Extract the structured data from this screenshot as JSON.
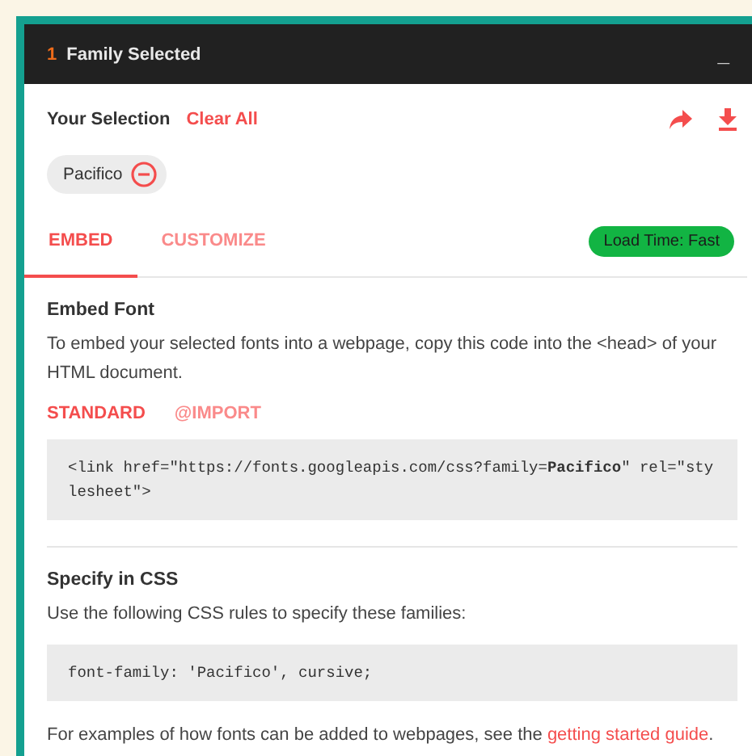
{
  "header": {
    "count": "1",
    "title": "Family Selected",
    "minimize": "_"
  },
  "selection": {
    "label": "Your Selection",
    "clear": "Clear All",
    "families": [
      {
        "name": "Pacifico"
      }
    ]
  },
  "tabs": [
    {
      "label": "EMBED",
      "selected": true
    },
    {
      "label": "CUSTOMIZE",
      "selected": false
    }
  ],
  "load_time": "Load Time: Fast",
  "embed": {
    "title": "Embed Font",
    "description": "To embed your selected fonts into a webpage, copy this code into the <head> of your HTML document.",
    "subtabs": [
      {
        "label": "STANDARD",
        "selected": true
      },
      {
        "label": "@IMPORT",
        "selected": false
      }
    ],
    "code": "<link href=\"https://fonts.googleapis.com/css?family=**Pacifico**\" rel=\"stylesheet\">"
  },
  "css": {
    "title": "Specify in CSS",
    "description": "Use the following CSS rules to specify these families:",
    "code": "font-family: 'Pacifico', cursive;"
  },
  "footer": {
    "text": "For examples of how fonts can be added to webpages, see the",
    "link": "getting started guide",
    "after": "."
  }
}
